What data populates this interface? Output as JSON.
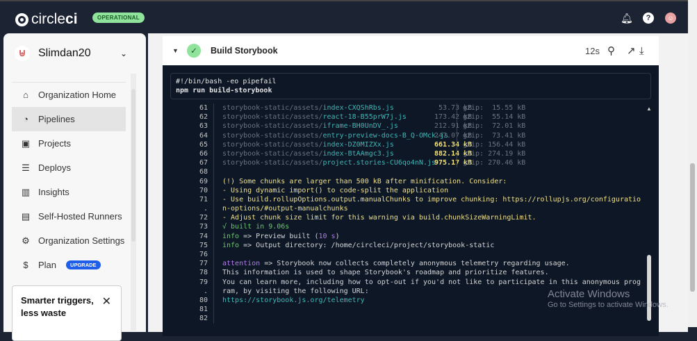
{
  "topbar": {
    "brand_light": "circle",
    "brand_bold": "ci",
    "status": "OPERATIONAL"
  },
  "sidebar": {
    "org": "Slimdan20",
    "items": [
      {
        "label": "Organization Home",
        "icon": "home-icon"
      },
      {
        "label": "Pipelines",
        "icon": "pipelines-icon",
        "active": true
      },
      {
        "label": "Projects",
        "icon": "projects-icon"
      },
      {
        "label": "Deploys",
        "icon": "deploys-icon"
      },
      {
        "label": "Insights",
        "icon": "insights-icon"
      },
      {
        "label": "Self-Hosted Runners",
        "icon": "runners-icon"
      },
      {
        "label": "Organization Settings",
        "icon": "gear-icon"
      },
      {
        "label": "Plan",
        "icon": "dollar-icon",
        "badge": "UPGRADE"
      }
    ],
    "promo": {
      "title": "Smarter triggers, less waste"
    }
  },
  "step": {
    "title": "Build Storybook",
    "duration": "12s"
  },
  "command": [
    "#!/bin/bash -eo pipefail",
    "npm run build-storybook"
  ],
  "log": [
    {
      "n": "61",
      "prefix": "storybook-static/assets/",
      "file": "index-CXQShRbs.js",
      "size": "53.73 kB",
      "gzip": "gzip:  15.55 kB",
      "big": false
    },
    {
      "n": "62",
      "prefix": "storybook-static/assets/",
      "file": "react-18-B55prW7j.js",
      "size": "173.42 kB",
      "gzip": "gzip:  55.14 kB",
      "big": false
    },
    {
      "n": "63",
      "prefix": "storybook-static/assets/",
      "file": "iframe-BH0UnDV_.js",
      "size": "212.91 kB",
      "gzip": "gzip:  72.01 kB",
      "big": false
    },
    {
      "n": "64",
      "prefix": "storybook-static/assets/",
      "file": "entry-preview-docs-B_Q-OMck.js",
      "size": "247.07 kB",
      "gzip": "gzip:  73.41 kB",
      "big": false
    },
    {
      "n": "65",
      "prefix": "storybook-static/assets/",
      "file": "index-DZ0MIZXx.js",
      "size": "661.34 kB",
      "gzip": "gzip: 156.44 kB",
      "big": true
    },
    {
      "n": "66",
      "prefix": "storybook-static/assets/",
      "file": "index-BtAAmgc3.js",
      "size": "882.14 kB",
      "gzip": "gzip: 274.19 kB",
      "big": true
    },
    {
      "n": "67",
      "prefix": "storybook-static/assets/",
      "file": "project.stories-CU6qo4nN.js",
      "size": "975.17 kB",
      "gzip": "gzip: 270.46 kB",
      "big": true
    }
  ],
  "log2": [
    {
      "n": "68",
      "t": "",
      "c": ""
    },
    {
      "n": "69",
      "t": "(!) Some chunks are larger than 500 kB after minification. Consider:",
      "c": "yl"
    },
    {
      "n": "70",
      "t": "- Using dynamic import() to code-split the application",
      "c": "yl"
    },
    {
      "n": "71",
      "t": "- Use build.rollupOptions.output.manualChunks to improve chunking: https://rollupjs.org/configuratio",
      "c": "yl"
    },
    {
      "n": ".",
      "t": "n-options/#output-manualchunks",
      "c": "yl"
    },
    {
      "n": "72",
      "t": "- Adjust chunk size limit for this warning via build.chunkSizeWarningLimit.",
      "c": "yl"
    },
    {
      "n": "73",
      "t": "√ built in 9.06s",
      "c": "gr"
    }
  ],
  "info": [
    {
      "n": "74",
      "tag": "info",
      "a": " => Preview built (",
      "b": "10 s",
      "c": ")"
    },
    {
      "n": "75",
      "tag": "info",
      "a": " => Output directory: /home/circleci/project/storybook-static",
      "b": "",
      "c": ""
    }
  ],
  "log3": [
    {
      "n": "76",
      "t": ""
    },
    {
      "n": "77",
      "tag": "attention",
      "t": " => Storybook now collects completely anonymous telemetry regarding usage."
    },
    {
      "n": "78",
      "t": "This information is used to shape Storybook's roadmap and prioritize features."
    },
    {
      "n": "79",
      "t": "You can learn more, including how to opt-out if you'd not like to participate in this anonymous prog"
    },
    {
      "n": ".",
      "t": "ram, by visiting the following URL:"
    },
    {
      "n": "80",
      "t": "https://storybook.js.org/telemetry",
      "link": true
    },
    {
      "n": "81",
      "t": ""
    },
    {
      "n": "82",
      "t": ""
    }
  ],
  "watermark": {
    "title": "Activate Windows",
    "sub": "Go to Settings to activate Windows."
  }
}
